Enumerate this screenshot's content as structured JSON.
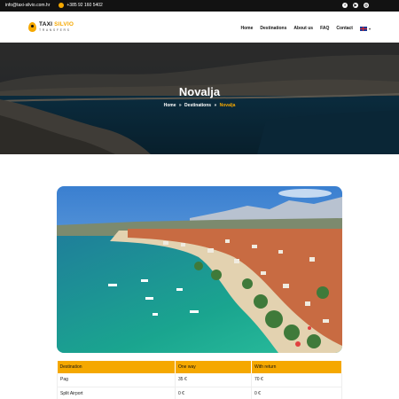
{
  "topbar": {
    "email": "info@taxi-silvio.com.hr",
    "phone": "+385 92 160 5402",
    "social": [
      "facebook-icon",
      "youtube-icon",
      "instagram-icon"
    ]
  },
  "header": {
    "logo_main_1": "TAXI ",
    "logo_main_2": "SILVIO",
    "logo_sub": "TRANSFERS",
    "nav": [
      "Home",
      "Destinations",
      "About us",
      "FAQ",
      "Contact"
    ],
    "language": "EN"
  },
  "hero": {
    "title": "Novalja",
    "breadcrumb": {
      "home": "Home",
      "separator": "»",
      "section": "Destinations",
      "current": "Novalja"
    }
  },
  "prices": {
    "headers": [
      "Destination",
      "One way",
      "With return"
    ],
    "rows": [
      [
        "Pag",
        "35 €",
        "70 €"
      ],
      [
        "Split Airport",
        "0 €",
        "0 €"
      ]
    ]
  },
  "colors": {
    "accent": "#f5a800",
    "dark": "#121212"
  }
}
